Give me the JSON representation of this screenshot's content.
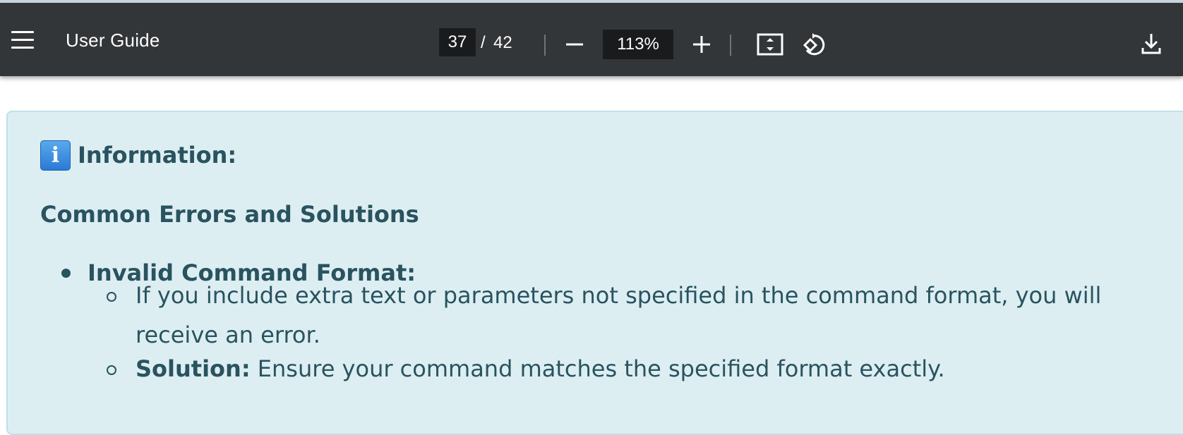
{
  "toolbar": {
    "title": "User Guide",
    "current_page": "37",
    "page_separator": "/",
    "total_pages": "42",
    "zoom": "113%",
    "icons": {
      "menu": "hamburger-menu-icon",
      "zoom_out": "minus-icon",
      "zoom_in": "plus-icon",
      "fit": "fit-to-page-icon",
      "rotate": "rotate-icon",
      "download": "download-icon"
    }
  },
  "content": {
    "info_label": "Information:",
    "section_title": "Common Errors and Solutions",
    "bullet_title": "Invalid Command Format:",
    "sub_items": [
      {
        "bold": "",
        "text": "If you include extra text or parameters not specified in the command format, you will receive an error."
      },
      {
        "bold": "Solution:",
        "text": "Ensure your command matches the specified format exactly."
      }
    ]
  },
  "colors": {
    "toolbar_bg": "#323639",
    "panel_bg": "#ddeef3",
    "panel_text": "#2a5360"
  }
}
